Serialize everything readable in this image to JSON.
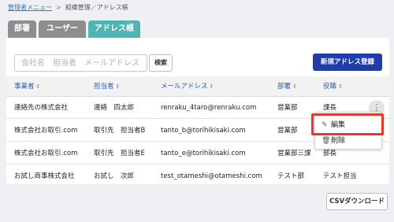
{
  "breadcrumb": {
    "link": "管理者メニュー",
    "separator": ">",
    "current": "組織管理／アドレス帳"
  },
  "tabs": [
    {
      "label": "部署",
      "active": false
    },
    {
      "label": "ユーザー",
      "active": false
    },
    {
      "label": "アドレス帳",
      "active": true
    }
  ],
  "search": {
    "placeholder": "会社名　担当者　メールアドレス",
    "button_label": "検索"
  },
  "new_button_label": "新規アドレス登録",
  "sort_icon": "⇕",
  "columns": [
    "事業者",
    "担当者",
    "メールアドレス",
    "部署",
    "役職"
  ],
  "rows": [
    {
      "company": "連絡先の株式会社",
      "person": "連絡　四太郎",
      "email": "renraku_4taro@renraku.com",
      "dept": "営業部",
      "title": "課長"
    },
    {
      "company": "株式会社お取引.com",
      "person": "取引先　担当者B",
      "email": "tanto_b@torihikisaki.com",
      "dept": "営業部",
      "title": ""
    },
    {
      "company": "株式会社お取引.com",
      "person": "取引先　担当者E",
      "email": "tanto_e@torihikisaki.com",
      "dept": "営業部三課",
      "title": "部長"
    },
    {
      "company": "お試し商事株式会社",
      "person": "お試し　次郎",
      "email": "test_otameshi@otameshi.com",
      "dept": "テスト部",
      "title": "テスト担当"
    }
  ],
  "row_menu": {
    "edit_label": "編集",
    "delete_label": "削除"
  },
  "csv_button_label": "CSVダウンロード",
  "colors": {
    "active_tab": "#4db6b5",
    "primary_button": "#1f3da8",
    "highlight": "#e23a2a",
    "link": "#2d5ba8"
  }
}
